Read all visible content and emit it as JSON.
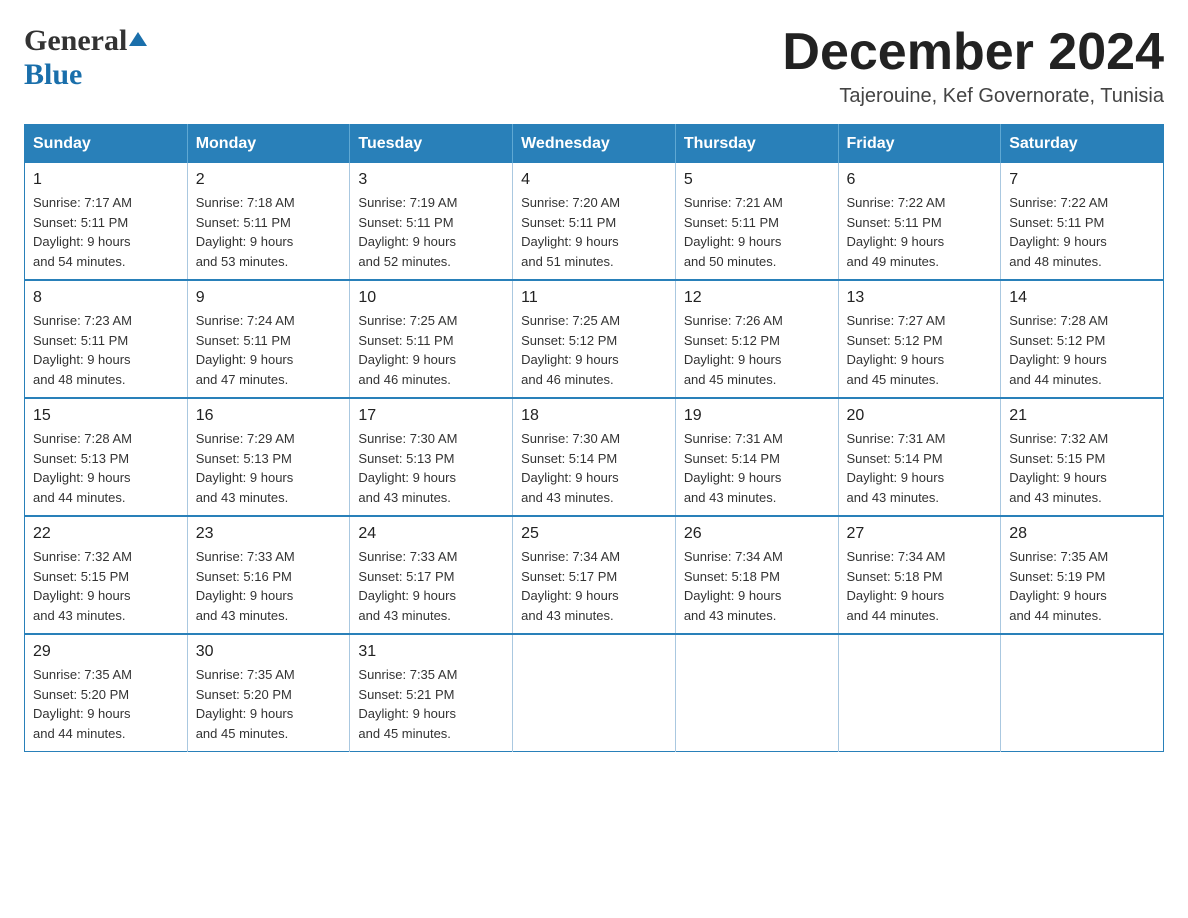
{
  "header": {
    "logo_general": "General",
    "logo_blue": "Blue",
    "month_title": "December 2024",
    "location": "Tajerouine, Kef Governorate, Tunisia"
  },
  "weekdays": [
    "Sunday",
    "Monday",
    "Tuesday",
    "Wednesday",
    "Thursday",
    "Friday",
    "Saturday"
  ],
  "weeks": [
    [
      {
        "day": "1",
        "sunrise": "7:17 AM",
        "sunset": "5:11 PM",
        "daylight": "9 hours and 54 minutes."
      },
      {
        "day": "2",
        "sunrise": "7:18 AM",
        "sunset": "5:11 PM",
        "daylight": "9 hours and 53 minutes."
      },
      {
        "day": "3",
        "sunrise": "7:19 AM",
        "sunset": "5:11 PM",
        "daylight": "9 hours and 52 minutes."
      },
      {
        "day": "4",
        "sunrise": "7:20 AM",
        "sunset": "5:11 PM",
        "daylight": "9 hours and 51 minutes."
      },
      {
        "day": "5",
        "sunrise": "7:21 AM",
        "sunset": "5:11 PM",
        "daylight": "9 hours and 50 minutes."
      },
      {
        "day": "6",
        "sunrise": "7:22 AM",
        "sunset": "5:11 PM",
        "daylight": "9 hours and 49 minutes."
      },
      {
        "day": "7",
        "sunrise": "7:22 AM",
        "sunset": "5:11 PM",
        "daylight": "9 hours and 48 minutes."
      }
    ],
    [
      {
        "day": "8",
        "sunrise": "7:23 AM",
        "sunset": "5:11 PM",
        "daylight": "9 hours and 48 minutes."
      },
      {
        "day": "9",
        "sunrise": "7:24 AM",
        "sunset": "5:11 PM",
        "daylight": "9 hours and 47 minutes."
      },
      {
        "day": "10",
        "sunrise": "7:25 AM",
        "sunset": "5:11 PM",
        "daylight": "9 hours and 46 minutes."
      },
      {
        "day": "11",
        "sunrise": "7:25 AM",
        "sunset": "5:12 PM",
        "daylight": "9 hours and 46 minutes."
      },
      {
        "day": "12",
        "sunrise": "7:26 AM",
        "sunset": "5:12 PM",
        "daylight": "9 hours and 45 minutes."
      },
      {
        "day": "13",
        "sunrise": "7:27 AM",
        "sunset": "5:12 PM",
        "daylight": "9 hours and 45 minutes."
      },
      {
        "day": "14",
        "sunrise": "7:28 AM",
        "sunset": "5:12 PM",
        "daylight": "9 hours and 44 minutes."
      }
    ],
    [
      {
        "day": "15",
        "sunrise": "7:28 AM",
        "sunset": "5:13 PM",
        "daylight": "9 hours and 44 minutes."
      },
      {
        "day": "16",
        "sunrise": "7:29 AM",
        "sunset": "5:13 PM",
        "daylight": "9 hours and 43 minutes."
      },
      {
        "day": "17",
        "sunrise": "7:30 AM",
        "sunset": "5:13 PM",
        "daylight": "9 hours and 43 minutes."
      },
      {
        "day": "18",
        "sunrise": "7:30 AM",
        "sunset": "5:14 PM",
        "daylight": "9 hours and 43 minutes."
      },
      {
        "day": "19",
        "sunrise": "7:31 AM",
        "sunset": "5:14 PM",
        "daylight": "9 hours and 43 minutes."
      },
      {
        "day": "20",
        "sunrise": "7:31 AM",
        "sunset": "5:14 PM",
        "daylight": "9 hours and 43 minutes."
      },
      {
        "day": "21",
        "sunrise": "7:32 AM",
        "sunset": "5:15 PM",
        "daylight": "9 hours and 43 minutes."
      }
    ],
    [
      {
        "day": "22",
        "sunrise": "7:32 AM",
        "sunset": "5:15 PM",
        "daylight": "9 hours and 43 minutes."
      },
      {
        "day": "23",
        "sunrise": "7:33 AM",
        "sunset": "5:16 PM",
        "daylight": "9 hours and 43 minutes."
      },
      {
        "day": "24",
        "sunrise": "7:33 AM",
        "sunset": "5:17 PM",
        "daylight": "9 hours and 43 minutes."
      },
      {
        "day": "25",
        "sunrise": "7:34 AM",
        "sunset": "5:17 PM",
        "daylight": "9 hours and 43 minutes."
      },
      {
        "day": "26",
        "sunrise": "7:34 AM",
        "sunset": "5:18 PM",
        "daylight": "9 hours and 43 minutes."
      },
      {
        "day": "27",
        "sunrise": "7:34 AM",
        "sunset": "5:18 PM",
        "daylight": "9 hours and 44 minutes."
      },
      {
        "day": "28",
        "sunrise": "7:35 AM",
        "sunset": "5:19 PM",
        "daylight": "9 hours and 44 minutes."
      }
    ],
    [
      {
        "day": "29",
        "sunrise": "7:35 AM",
        "sunset": "5:20 PM",
        "daylight": "9 hours and 44 minutes."
      },
      {
        "day": "30",
        "sunrise": "7:35 AM",
        "sunset": "5:20 PM",
        "daylight": "9 hours and 45 minutes."
      },
      {
        "day": "31",
        "sunrise": "7:35 AM",
        "sunset": "5:21 PM",
        "daylight": "9 hours and 45 minutes."
      },
      null,
      null,
      null,
      null
    ]
  ],
  "labels": {
    "sunrise": "Sunrise:",
    "sunset": "Sunset:",
    "daylight": "Daylight:"
  }
}
